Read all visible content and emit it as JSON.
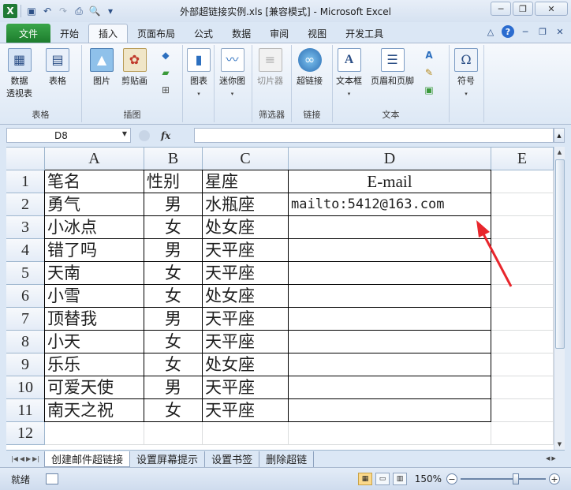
{
  "window": {
    "title": "外部超链接实例.xls  [兼容模式] - Microsoft Excel",
    "app_icon": "excel-icon",
    "win_buttons": [
      "─",
      "❐",
      "✕"
    ]
  },
  "ribbon": {
    "file_tab": "文件",
    "tabs": [
      "开始",
      "插入",
      "页面布局",
      "公式",
      "数据",
      "审阅",
      "视图",
      "开发工具"
    ],
    "active_tab": "插入",
    "groups": {
      "tables": {
        "label": "表格",
        "pivot": "数据\n透视表",
        "table": "表格"
      },
      "illustrations": {
        "label": "插图",
        "picture": "图片",
        "clipart": "剪贴画"
      },
      "charts": {
        "chart": "图表"
      },
      "sparklines": {
        "mini": "迷你图"
      },
      "filter": {
        "label": "筛选器",
        "slicer": "切片器"
      },
      "links": {
        "label": "链接",
        "hyperlink": "超链接"
      },
      "text": {
        "label": "文本",
        "textbox": "文本框",
        "header_footer": "页眉和页脚"
      },
      "symbols": {
        "symbol": "符号"
      }
    }
  },
  "formula_bar": {
    "name_box": "D8",
    "fx_label": "fx",
    "value": ""
  },
  "sheet": {
    "columns": [
      "A",
      "B",
      "C",
      "D",
      "E"
    ],
    "row_numbers": [
      "1",
      "2",
      "3",
      "4",
      "5",
      "6",
      "7",
      "8",
      "9",
      "10",
      "11",
      "12"
    ],
    "rows": [
      [
        "笔名",
        "性别",
        "星座",
        "E-mail"
      ],
      [
        "勇气",
        "男",
        "水瓶座",
        "mailto:5412@163.com"
      ],
      [
        "小冰点",
        "女",
        "处女座",
        ""
      ],
      [
        "错了吗",
        "男",
        "天平座",
        ""
      ],
      [
        "天南",
        "女",
        "天平座",
        ""
      ],
      [
        "小雪",
        "女",
        "处女座",
        ""
      ],
      [
        "顶替我",
        "男",
        "天平座",
        ""
      ],
      [
        "小天",
        "女",
        "天平座",
        ""
      ],
      [
        "乐乐",
        "女",
        "处女座",
        ""
      ],
      [
        "可爱天使",
        "男",
        "天平座",
        ""
      ],
      [
        "南天之祝",
        "女",
        "天平座",
        ""
      ]
    ],
    "annotation_color": "#e8262c"
  },
  "sheet_tabs": {
    "tabs": [
      "创建邮件超链接",
      "设置屏幕提示",
      "设置书签",
      "删除超链"
    ],
    "active": 0
  },
  "status_bar": {
    "ready": "就绪",
    "zoom": "150%",
    "zoom_level": 0.65
  }
}
